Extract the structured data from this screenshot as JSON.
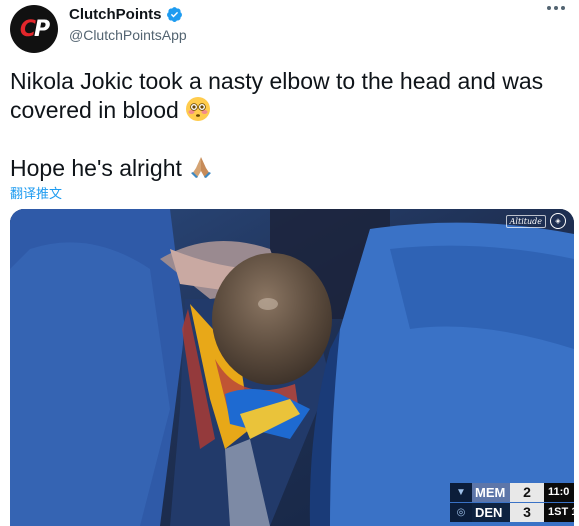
{
  "account": {
    "display_name": "ClutchPoints",
    "handle": "@ClutchPointsApp",
    "avatar_text_c": "C",
    "avatar_text_p": "P",
    "verified_icon": "verified-badge-icon",
    "verified_color": "#1d9bf0"
  },
  "tweet": {
    "line1": "Nikola Jokic took a nasty elbow to the head and was",
    "line2": "covered in blood",
    "line3": "Hope he's alright",
    "emoji1": "flushed-face-icon",
    "emoji2": "folded-hands-icon",
    "translate_label": "翻译推文"
  },
  "media": {
    "broadcast_bug": "Altitude",
    "scoreboard": {
      "team1": {
        "abbr": "MEM",
        "score": "2"
      },
      "team2": {
        "abbr": "DEN",
        "score": "3"
      },
      "clock": "11:0",
      "period": "1ST 1"
    }
  },
  "colors": {
    "link": "#1d9bf0",
    "text": "#0f1419",
    "secondary": "#536471",
    "brand_red": "#e3262b"
  }
}
